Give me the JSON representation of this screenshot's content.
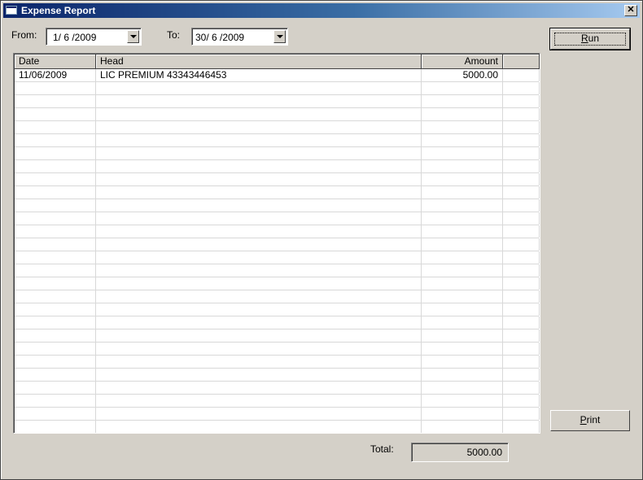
{
  "window": {
    "title": "Expense Report",
    "close_label": "✕"
  },
  "filters": {
    "from_label": "From:",
    "from_value": "1/ 6 /2009",
    "to_label": "To:",
    "to_value": "30/ 6 /2009"
  },
  "buttons": {
    "run_label": "Run",
    "run_accel": "R",
    "run_rest": "un",
    "print_label": "Print",
    "print_accel": "P",
    "print_rest": "rint"
  },
  "table": {
    "columns": [
      "Date",
      "Head",
      "Amount",
      ""
    ],
    "rows": [
      [
        "11/06/2009",
        "LIC PREMIUM 43343446453",
        "5000.00",
        ""
      ]
    ]
  },
  "footer": {
    "total_label": "Total:",
    "total_value": "5000.00"
  }
}
